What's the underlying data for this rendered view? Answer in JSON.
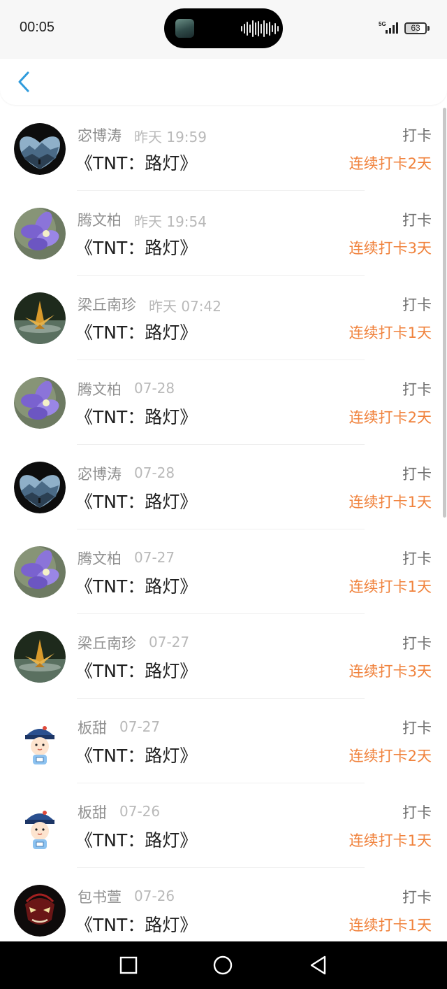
{
  "status_bar": {
    "time": "00:05",
    "network": "5G",
    "battery": "63"
  },
  "header": {
    "back_icon": "chevron-left-icon"
  },
  "records": [
    {
      "name": "宓博涛",
      "date": "昨天 19:59",
      "title": "《TNT：路灯》",
      "action": "打卡",
      "streak": "连续打卡2天",
      "avatar": "mountain"
    },
    {
      "name": "腾文柏",
      "date": "昨天 19:54",
      "title": "《TNT：路灯》",
      "action": "打卡",
      "streak": "连续打卡3天",
      "avatar": "flower"
    },
    {
      "name": "梁丘南珍",
      "date": "昨天 07:42",
      "title": "《TNT：路灯》",
      "action": "打卡",
      "streak": "连续打卡1天",
      "avatar": "crane"
    },
    {
      "name": "腾文柏",
      "date": "07-28",
      "title": "《TNT：路灯》",
      "action": "打卡",
      "streak": "连续打卡2天",
      "avatar": "flower"
    },
    {
      "name": "宓博涛",
      "date": "07-28",
      "title": "《TNT：路灯》",
      "action": "打卡",
      "streak": "连续打卡1天",
      "avatar": "mountain"
    },
    {
      "name": "腾文柏",
      "date": "07-27",
      "title": "《TNT：路灯》",
      "action": "打卡",
      "streak": "连续打卡1天",
      "avatar": "flower"
    },
    {
      "name": "梁丘南珍",
      "date": "07-27",
      "title": "《TNT：路灯》",
      "action": "打卡",
      "streak": "连续打卡3天",
      "avatar": "crane"
    },
    {
      "name": "板甜",
      "date": "07-27",
      "title": "《TNT：路灯》",
      "action": "打卡",
      "streak": "连续打卡2天",
      "avatar": "cartoon"
    },
    {
      "name": "板甜",
      "date": "07-26",
      "title": "《TNT：路灯》",
      "action": "打卡",
      "streak": "连续打卡1天",
      "avatar": "cartoon"
    },
    {
      "name": "包书萱",
      "date": "07-26",
      "title": "《TNT：路灯》",
      "action": "打卡",
      "streak": "连续打卡1天",
      "avatar": "mask"
    }
  ],
  "colors": {
    "accent": "#2f9bdc",
    "streak": "#f0823c",
    "name": "#8f8f8f",
    "date": "#b9b9b9"
  }
}
